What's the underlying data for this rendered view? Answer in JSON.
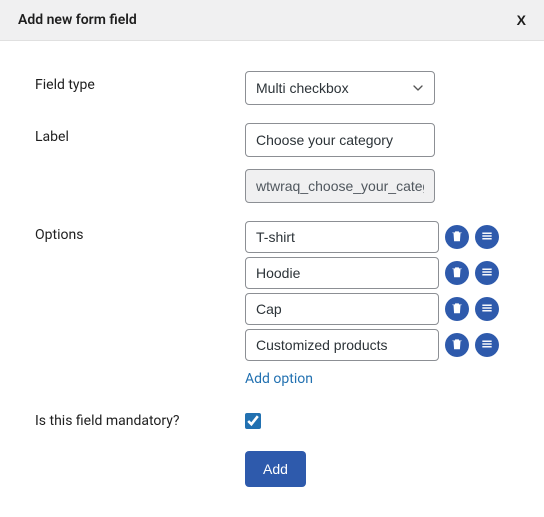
{
  "header": {
    "title": "Add new form field",
    "close_label": "X"
  },
  "form": {
    "field_type": {
      "label": "Field type",
      "selected": "Multi checkbox"
    },
    "label_field": {
      "label": "Label",
      "value": "Choose your category",
      "slug": "wtwraq_choose_your_category"
    },
    "options": {
      "label": "Options",
      "items": [
        {
          "value": "T-shirt"
        },
        {
          "value": "Hoodie"
        },
        {
          "value": "Cap"
        },
        {
          "value": "Customized products"
        }
      ],
      "add_link": "Add option"
    },
    "mandatory": {
      "label": "Is this field mandatory?",
      "checked": true
    },
    "submit_label": "Add"
  }
}
